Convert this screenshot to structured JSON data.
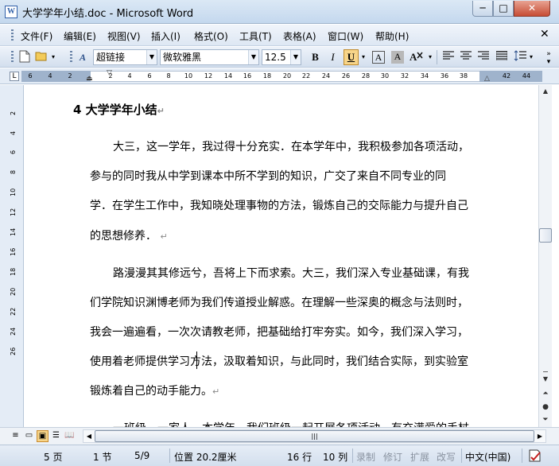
{
  "window": {
    "title": "大学学年小结.doc - Microsoft Word",
    "app_icon": "W",
    "minimize_glyph": "─",
    "maximize_glyph": "□",
    "close_glyph": "✕"
  },
  "menu": {
    "items": [
      "文件(F)",
      "编辑(E)",
      "视图(V)",
      "插入(I)",
      "格式(O)",
      "工具(T)",
      "表格(A)",
      "窗口(W)",
      "帮助(H)"
    ],
    "close_glyph": "✕"
  },
  "toolbar": {
    "style_value": "超链接",
    "font_value": "微软雅黑",
    "size_value": "12.5",
    "bold": "B",
    "italic": "I",
    "underline": "U",
    "char_border": "A",
    "char_shading": "A",
    "style_glyph": "A",
    "underline_active_color": "#f7d58a"
  },
  "ruler": {
    "corner": "L",
    "ticks": [
      "6",
      "4",
      "2",
      "2",
      "4",
      "6",
      "8",
      "10",
      "12",
      "14",
      "16",
      "18",
      "20",
      "22",
      "24",
      "26",
      "28",
      "30",
      "32",
      "34",
      "36",
      "38",
      "42",
      "44"
    ]
  },
  "vruler": {
    "ticks": [
      "2",
      "4",
      "6",
      "8",
      "10",
      "12",
      "14",
      "16",
      "18",
      "20",
      "22",
      "24",
      "26"
    ]
  },
  "document": {
    "heading": "4 大学学年小结",
    "lines": [
      {
        "text": "大三，这一学年，我过得十分充实．在本学年中，我积极参加各项活动，",
        "indent": true,
        "mark": false
      },
      {
        "text": "参与的同时我从中学到课本中所不学到的知识，广交了来自不同专业的同",
        "indent": false,
        "mark": false
      },
      {
        "text": "学．在学生工作中，我知晓处理事物的方法，锻炼自己的交际能力与提升自己",
        "indent": false,
        "mark": false
      },
      {
        "text": "的思想修养．",
        "indent": false,
        "mark": true
      },
      {
        "text": "路漫漫其其修远兮，吾将上下而求索。大三，我们深入专业基础课，有我",
        "indent": true,
        "mark": false
      },
      {
        "text": "们学院知识渊博老师为我们传道授业解惑。在理解一些深奥的概念与法则时，",
        "indent": false,
        "mark": false
      },
      {
        "text": "我会一遍遍看，一次次请教老师，把基础给打牢夯实。如今，我们深入学习，",
        "indent": false,
        "mark": false
      },
      {
        "text": "使用着老师提供学习方法，汲取着知识，与此同时，我们结合实际，到实验室",
        "indent": false,
        "mark": false
      },
      {
        "text": "锻炼着自己的动手能力。",
        "indent": false,
        "mark": true
      },
      {
        "text": "一班级，一家人。本学年，我们班级一起开展各项活动，有充满爱的手杖",
        "indent": true,
        "mark": false
      }
    ],
    "paragraph_mark": "↵"
  },
  "status": {
    "page": "5 页",
    "section": "1 节",
    "page_of": "5/9",
    "position": "位置 20.2厘米",
    "line": "16 行",
    "column": "10 列",
    "rec": "录制",
    "trk": "修订",
    "ext": "扩展",
    "ovr": "改写",
    "language": "中文(中国)"
  }
}
